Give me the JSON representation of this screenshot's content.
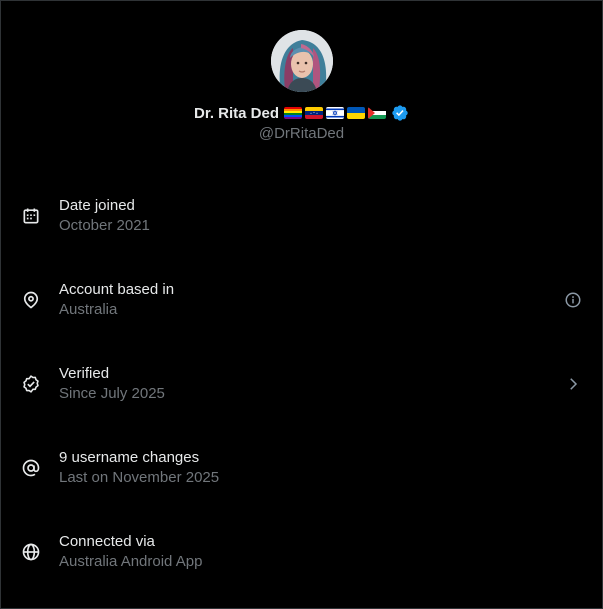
{
  "profile": {
    "display_name": "Dr. Rita Ded",
    "handle": "@DrRitaDed",
    "flags": [
      "rainbow-flag",
      "venezuela-flag",
      "israel-flag",
      "ukraine-flag",
      "palestine-flag"
    ],
    "verified_badge_color": "#1d9bf0"
  },
  "rows": [
    {
      "icon": "calendar-icon",
      "title": "Date joined",
      "subtitle": "October 2021",
      "trailing": ""
    },
    {
      "icon": "location-pin-icon",
      "title": "Account based in",
      "subtitle": "Australia",
      "trailing": "info-icon"
    },
    {
      "icon": "verified-check-icon",
      "title": "Verified",
      "subtitle": "Since July 2025",
      "trailing": "chevron-right-icon"
    },
    {
      "icon": "at-sign-icon",
      "title": "9 username changes",
      "subtitle": "Last on November 2025",
      "trailing": ""
    },
    {
      "icon": "globe-icon",
      "title": "Connected via",
      "subtitle": "Australia Android App",
      "trailing": ""
    }
  ],
  "colors": {
    "background": "#000000",
    "primary_text": "#e7e9ea",
    "secondary_text": "#71767b",
    "accent": "#1d9bf0"
  }
}
